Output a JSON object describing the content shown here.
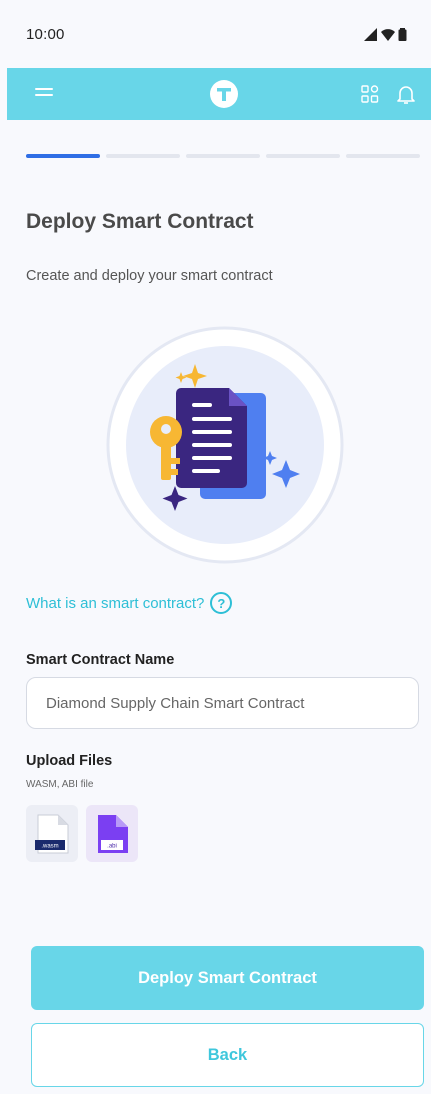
{
  "status_bar": {
    "time": "10:00"
  },
  "app_bar": {
    "background_color": "#68d6e8",
    "icons": [
      "menu-icon",
      "app-logo-icon",
      "apps-grid-icon",
      "bell-icon"
    ]
  },
  "stepper": {
    "total_steps": 5,
    "current_step": 1,
    "active_color": "#2f6ee5"
  },
  "page": {
    "title": "Deploy Smart Contract",
    "subtitle": "Create and deploy your smart contract"
  },
  "help_link": {
    "label": "What is an smart contract?",
    "icon": "?"
  },
  "form": {
    "name_label": "Smart Contract Name",
    "name_value": "Diamond Supply Chain Smart Contract",
    "upload_label": "Upload Files",
    "upload_hint": "WASM, ABI file",
    "files": [
      {
        "type_label": ".wasm",
        "icon": "wasm-file-icon"
      },
      {
        "type_label": ".abi",
        "icon": "abi-file-icon"
      }
    ]
  },
  "actions": {
    "primary_label": "Deploy Smart Contract",
    "secondary_label": "Back"
  }
}
